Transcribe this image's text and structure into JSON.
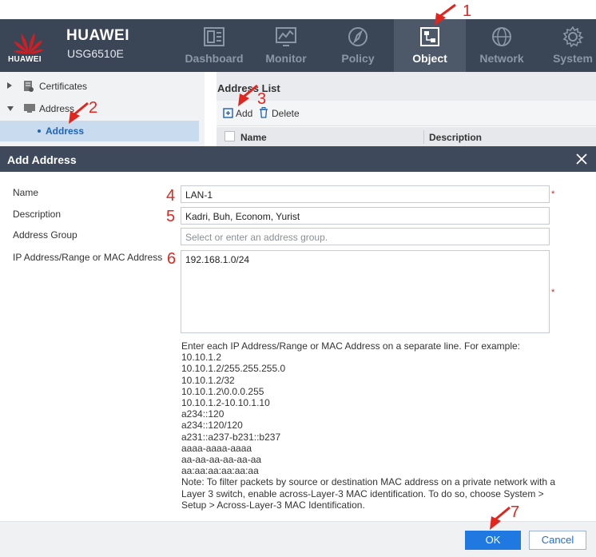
{
  "header": {
    "logo_text": "HUAWEI",
    "brand": "HUAWEI",
    "model": "USG6510E",
    "nav": [
      {
        "label": "Dashboard",
        "icon": "dashboard-icon"
      },
      {
        "label": "Monitor",
        "icon": "monitor-icon"
      },
      {
        "label": "Policy",
        "icon": "compass-icon"
      },
      {
        "label": "Object",
        "icon": "object-icon",
        "active": true
      },
      {
        "label": "Network",
        "icon": "globe-icon"
      },
      {
        "label": "System",
        "icon": "gear-icon"
      }
    ]
  },
  "tree": {
    "items": [
      {
        "label": "Certificates",
        "icon": "certificate-icon"
      },
      {
        "label": "Address",
        "icon": "address-folder-icon"
      },
      {
        "label": "Address",
        "selected": true
      }
    ]
  },
  "address_list": {
    "title": "Address List",
    "add_label": "Add",
    "delete_label": "Delete",
    "columns": [
      "Name",
      "Description"
    ]
  },
  "dialog": {
    "title": "Add Address",
    "fields": {
      "name": {
        "label": "Name",
        "value": "LAN-1",
        "required_mark": "*"
      },
      "description": {
        "label": "Description",
        "value": "Kadri, Buh, Econom, Yurist"
      },
      "address_group": {
        "label": "Address Group",
        "placeholder": "Select or enter an address group."
      },
      "ip": {
        "label": "IP Address/Range or MAC Address",
        "value": "192.168.1.0/24",
        "required_mark": "*"
      }
    },
    "help_intro": "Enter each IP Address/Range or MAC Address on a separate line. For example:",
    "help_examples": [
      "10.10.1.2",
      "10.10.1.2/255.255.255.0",
      "10.10.1.2/32",
      "10.10.1.2\\0.0.0.255",
      "10.10.1.2-10.10.1.10",
      "a234::120",
      "a234::120/120",
      "a231::a237-b231::b237",
      "aaaa-aaaa-aaaa",
      "aa-aa-aa-aa-aa-aa",
      "aa:aa:aa:aa:aa:aa"
    ],
    "help_note": "Note: To filter packets by source or destination MAC address on a private network with a Layer 3 switch, enable across-Layer-3 MAC identification. To do so, choose System > Setup > Across-Layer-3 MAC Identification.",
    "ok_label": "OK",
    "cancel_label": "Cancel"
  },
  "annotations": [
    "1",
    "2",
    "3",
    "4",
    "5",
    "6",
    "7"
  ],
  "colors": {
    "header_bg": "#3a4556",
    "active_tab": "#4d5869",
    "ok_button": "#1f79e0",
    "annotation_red": "#e0261f",
    "logo_red": "#cf1f25"
  }
}
